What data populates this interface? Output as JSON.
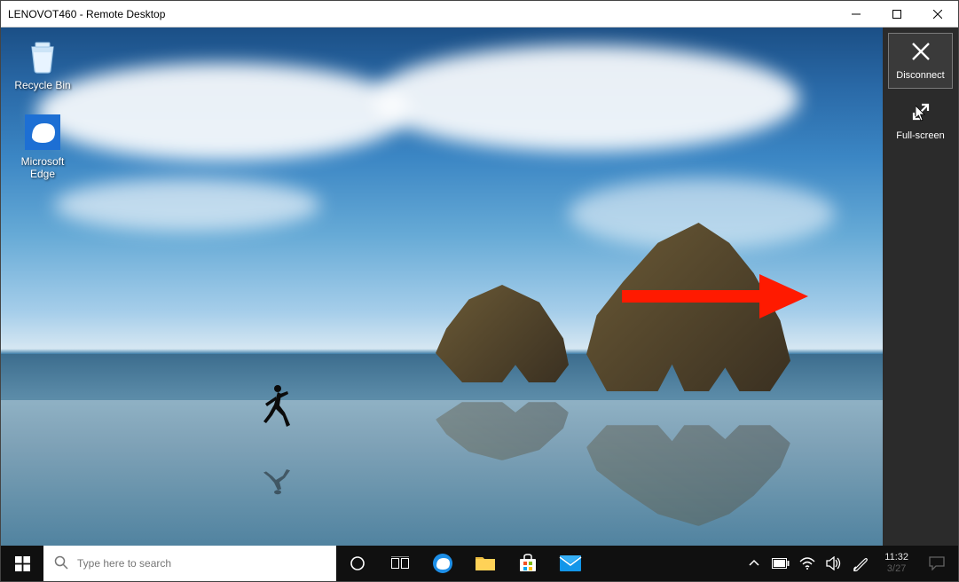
{
  "window": {
    "title": "LENOVOT460 - Remote Desktop"
  },
  "desktop": {
    "icons": [
      {
        "label": "Recycle Bin"
      },
      {
        "label": "Microsoft Edge"
      }
    ]
  },
  "sidepanel": {
    "disconnect_label": "Disconnect",
    "fullscreen_label": "Full-screen"
  },
  "taskbar": {
    "search_placeholder": "Type here to search",
    "time": "11:32",
    "date": "3/27"
  }
}
